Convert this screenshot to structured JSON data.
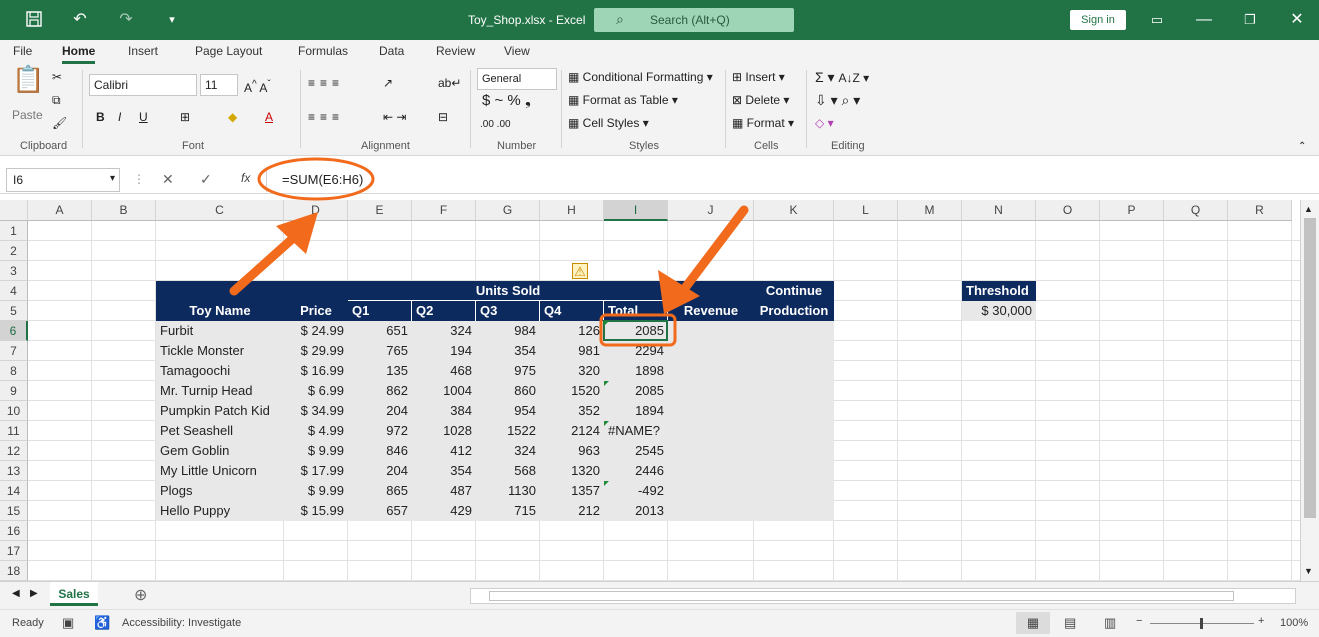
{
  "window": {
    "title": "Toy_Shop.xlsx - Excel",
    "search_placeholder": "Search (Alt+Q)",
    "sign_in": "Sign in"
  },
  "menu": [
    "File",
    "Home",
    "Insert",
    "Page Layout",
    "Formulas",
    "Data",
    "Review",
    "View"
  ],
  "ribbon": {
    "paste": "Paste",
    "font_name": "Calibri",
    "font_size": "11",
    "number_format": "General",
    "conditional_formatting": "Conditional Formatting",
    "format_as_table": "Format as Table",
    "cell_styles": "Cell Styles",
    "insert": "Insert",
    "delete": "Delete",
    "format": "Format",
    "groups": [
      "Clipboard",
      "Font",
      "Alignment",
      "Number",
      "Styles",
      "Cells",
      "Editing"
    ]
  },
  "formula_bar": {
    "name_box": "I6",
    "fx": "fx",
    "formula": "=SUM(E6:H6)"
  },
  "columns": [
    "A",
    "B",
    "C",
    "D",
    "E",
    "F",
    "G",
    "H",
    "I",
    "J",
    "K",
    "L",
    "M",
    "N",
    "O",
    "P",
    "Q",
    "R"
  ],
  "rows": [
    "1",
    "2",
    "3",
    "4",
    "5",
    "6",
    "7",
    "8",
    "9",
    "10",
    "11",
    "12",
    "13",
    "14",
    "15",
    "16",
    "17",
    "18"
  ],
  "table": {
    "header_toy_name": "Toy Name",
    "header_price": "Price",
    "header_units_sold": "Units Sold",
    "header_q": [
      "Q1",
      "Q2",
      "Q3",
      "Q4",
      "Total"
    ],
    "header_revenue": "Revenue",
    "header_continue_1": "Continue",
    "header_continue_2": "Production",
    "rows": [
      {
        "name": "Furbit",
        "price": "$ 24.99",
        "q": [
          "651",
          "324",
          "984",
          "126"
        ],
        "total": "2085"
      },
      {
        "name": "Tickle Monster",
        "price": "$ 29.99",
        "q": [
          "765",
          "194",
          "354",
          "981"
        ],
        "total": "2294"
      },
      {
        "name": "Tamagoochi",
        "price": "$ 16.99",
        "q": [
          "135",
          "468",
          "975",
          "320"
        ],
        "total": "1898"
      },
      {
        "name": "Mr. Turnip Head",
        "price": "$ 6.99",
        "q": [
          "862",
          "1004",
          "860",
          "1520"
        ],
        "total": "2085"
      },
      {
        "name": "Pumpkin Patch Kid",
        "price": "$ 34.99",
        "q": [
          "204",
          "384",
          "954",
          "352"
        ],
        "total": "1894"
      },
      {
        "name": "Pet Seashell",
        "price": "$ 4.99",
        "q": [
          "972",
          "1028",
          "1522",
          "2124"
        ],
        "total": "#NAME?"
      },
      {
        "name": "Gem Goblin",
        "price": "$ 9.99",
        "q": [
          "846",
          "412",
          "324",
          "963"
        ],
        "total": "2545"
      },
      {
        "name": "My Little Unicorn",
        "price": "$ 17.99",
        "q": [
          "204",
          "354",
          "568",
          "1320"
        ],
        "total": "2446"
      },
      {
        "name": "Plogs",
        "price": "$ 9.99",
        "q": [
          "865",
          "487",
          "1130",
          "1357"
        ],
        "total": "-492"
      },
      {
        "name": "Hello Puppy",
        "price": "$ 15.99",
        "q": [
          "657",
          "429",
          "715",
          "212"
        ],
        "total": "2013"
      }
    ],
    "threshold_label": "Threshold",
    "threshold_value": "$ 30,000"
  },
  "sheet_tab": "Sales",
  "status": {
    "ready": "Ready",
    "accessibility": "Accessibility: Investigate",
    "zoom": "100%"
  },
  "colors": {
    "excel_green": "#217346",
    "header_navy": "#0d2a5f",
    "annotation_orange": "#f26b1d"
  }
}
